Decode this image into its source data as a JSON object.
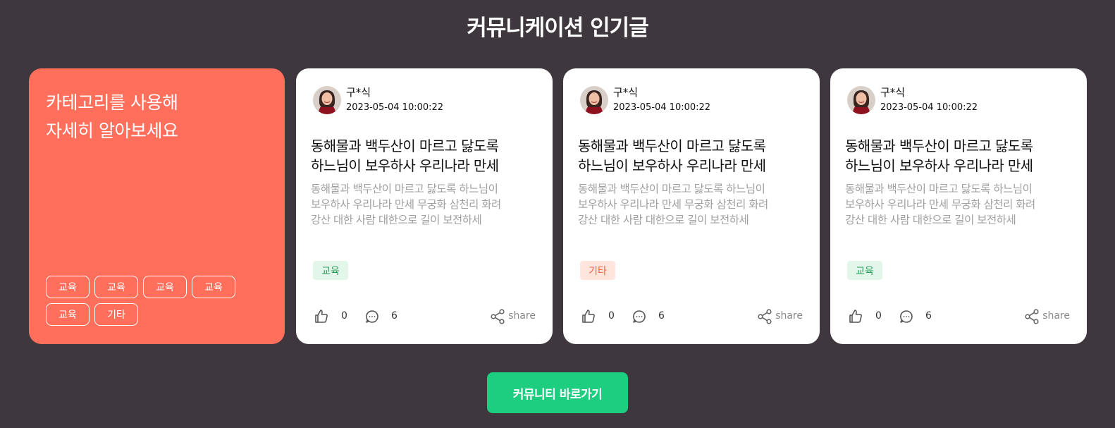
{
  "page_title": "커뮤니케이션 인기글",
  "promo": {
    "line1": "카테고리를 사용해",
    "line2": "자세히 알아보세요",
    "chips": [
      "교육",
      "교육",
      "교육",
      "교육",
      "교육",
      "기타"
    ]
  },
  "cards": [
    {
      "author": "구*식",
      "date": "2023-05-04 10:00:22",
      "title_line1": "동해물과 백두산이 마르고 닳도록",
      "title_line2": "하느님이 보우하사 우리나라 만세",
      "body_line1": "동해물과 백두산이 마르고 닳도록 하느님이",
      "body_line2": "보우하사 우리나라 만세 무궁화 삼천리 화려",
      "body_line3": "강산 대한 사람 대한으로 길이 보전하세",
      "tag": "교육",
      "tag_color": "#2e9e5f",
      "tag_bg": "#e3f6ea",
      "likes": "0",
      "comments": "6",
      "share_label": "share"
    },
    {
      "author": "구*식",
      "date": "2023-05-04 10:00:22",
      "title_line1": "동해물과 백두산이 마르고 닳도록",
      "title_line2": "하느님이 보우하사 우리나라 만세",
      "body_line1": "동해물과 백두산이 마르고 닳도록 하느님이",
      "body_line2": "보우하사 우리나라 만세 무궁화 삼천리 화려",
      "body_line3": "강산 대한 사람 대한으로 길이 보전하세",
      "tag": "기타",
      "tag_color": "#f0613f",
      "tag_bg": "#ffe5dc",
      "likes": "0",
      "comments": "6",
      "share_label": "share"
    },
    {
      "author": "구*식",
      "date": "2023-05-04 10:00:22",
      "title_line1": "동해물과 백두산이 마르고 닳도록",
      "title_line2": "하느님이 보우하사 우리나라 만세",
      "body_line1": "동해물과 백두산이 마르고 닳도록 하느님이",
      "body_line2": "보우하사 우리나라 만세 무궁화 삼천리 화려",
      "body_line3": "강산 대한 사람 대한으로 길이 보전하세",
      "tag": "교육",
      "tag_color": "#2e9e5f",
      "tag_bg": "#e3f6ea",
      "likes": "0",
      "comments": "6",
      "share_label": "share"
    }
  ],
  "cta_label": "커뮤니티 바로가기",
  "colors": {
    "background": "#3f373e",
    "promo": "#ff6f5c",
    "cta": "#1dce80"
  },
  "icons": {
    "like": "thumbs-up-icon",
    "comment": "chat-bubble-icon",
    "share": "share-icon"
  }
}
